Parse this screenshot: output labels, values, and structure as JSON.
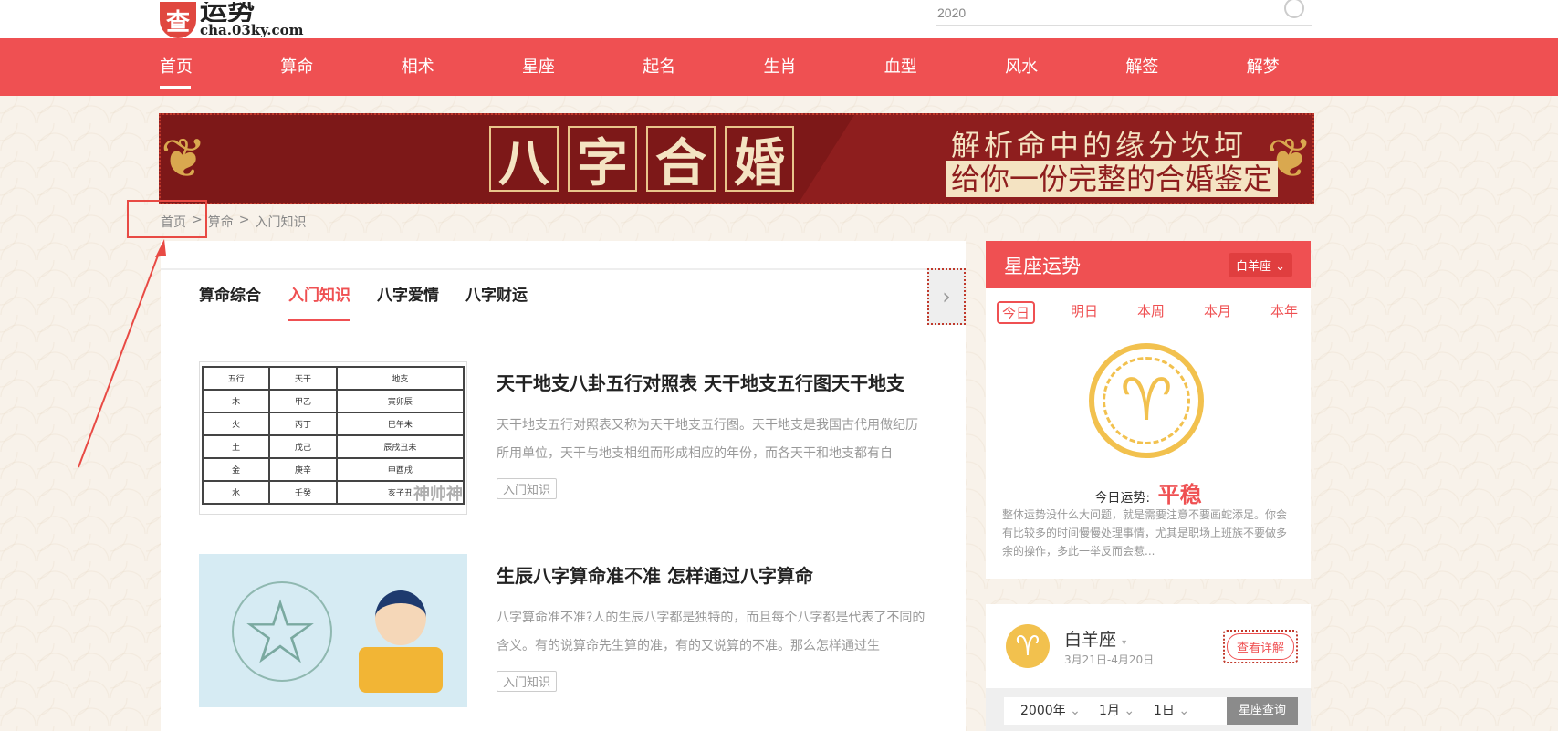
{
  "header": {
    "logo_char": "查",
    "logo_title": "运势",
    "logo_domain": "cha.03ky.com",
    "search_value": "2020"
  },
  "nav": {
    "items": [
      "首页",
      "算命",
      "相术",
      "星座",
      "起名",
      "生肖",
      "血型",
      "风水",
      "解签",
      "解梦"
    ]
  },
  "banner": {
    "chars": [
      "八",
      "字",
      "合",
      "婚"
    ],
    "line1": "解析命中的缘分坎坷",
    "line2": "给你一份完整的合婚鉴定"
  },
  "breadcrumb": {
    "home": "首页",
    "sep1": ">",
    "category": "算命",
    "sep2": ">",
    "current": "入门知识"
  },
  "tabs": [
    "算命综合",
    "入门知识",
    "八字爱情",
    "八字财运"
  ],
  "articles": [
    {
      "title": "天干地支八卦五行对照表 天干地支五行图天干地支",
      "desc": "天干地支五行对照表又称为天干地支五行图。天干地支是我国古代用做纪历所用单位，天干与地支相组而形成相应的年份，而各天干和地支都有自",
      "tag": "入门知识",
      "table": [
        [
          "五行",
          "天干",
          "地支"
        ],
        [
          "木",
          "甲乙",
          "寅卯辰"
        ],
        [
          "火",
          "丙丁",
          "巳午未"
        ],
        [
          "土",
          "戊己",
          "辰戌丑未"
        ],
        [
          "金",
          "庚辛",
          "申酉戌"
        ],
        [
          "水",
          "壬癸",
          "亥子丑"
        ]
      ],
      "watermark": "神帅神"
    },
    {
      "title": "生辰八字算命准不准 怎样通过八字算命",
      "desc": "八字算命准不准?人的生辰八字都是独特的，而且每个八字都是代表了不同的含义。有的说算命先生算的准，有的又说算的不准。那么怎样通过生",
      "tag": "入门知识"
    }
  ],
  "sidebar": {
    "title": "星座运势",
    "selected_sign": "白羊座",
    "periods": [
      "今日",
      "明日",
      "本周",
      "本月",
      "本年"
    ],
    "fortune_label": "今日运势:",
    "fortune_value": "平稳",
    "fortune_desc": "整体运势没什么大问题，就是需要注意不要画蛇添足。你会有比较多的时间慢慢处理事情，尤其是职场上班族不要做多余的操作，多此一举反而会惹...",
    "sign_name": "白羊座",
    "sign_dates": "3月21日-4月20日",
    "detail_button": "查看详解",
    "query": {
      "year": "2000年",
      "month": "1月",
      "day": "1日",
      "button": "星座查询"
    }
  },
  "colors": {
    "brand_red": "#ef5052",
    "banner_red": "#8e1e1e",
    "gold": "#f2c14e"
  }
}
